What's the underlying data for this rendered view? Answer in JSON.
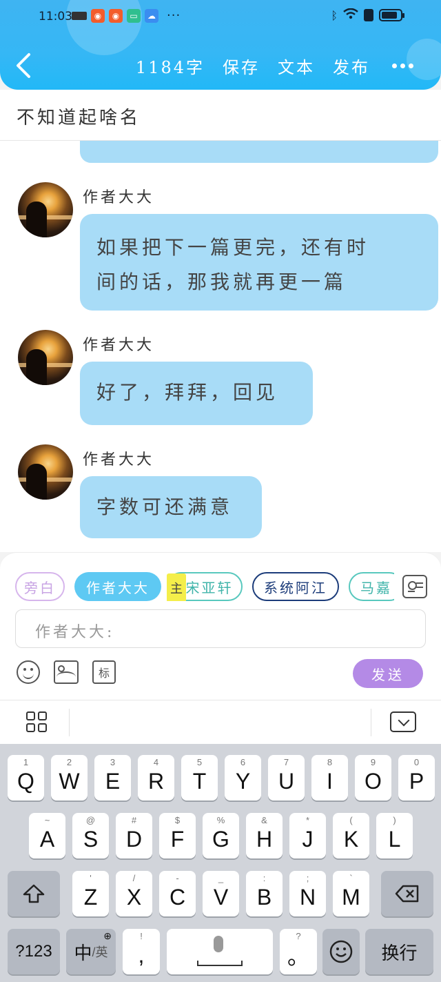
{
  "status_bar": {
    "time": "11:03",
    "more": "···"
  },
  "toolbar": {
    "word_count": "1184字",
    "save_label": "保存",
    "text_label": "文本",
    "publish_label": "发布"
  },
  "document": {
    "title": "不知道起啥名"
  },
  "messages": [
    {
      "author": "作者大大",
      "text_line1": "如果把下一篇更完，还有时",
      "text_line2": "间的话，那我就再更一篇"
    },
    {
      "author": "作者大大",
      "text": "好了，拜拜，回见"
    },
    {
      "author": "作者大大",
      "text": "字数可还满意"
    }
  ],
  "characters": {
    "chips": [
      {
        "label": "旁白"
      },
      {
        "label": "作者大大"
      },
      {
        "label": "宋亚轩",
        "tag": "主"
      },
      {
        "label": "系统阿江"
      },
      {
        "label": "马嘉"
      }
    ]
  },
  "compose": {
    "input_value": "作者大大:",
    "tag_tool_label": "标",
    "send_label": "发送"
  },
  "keyboard": {
    "row1": [
      {
        "key": "Q",
        "hint": "1"
      },
      {
        "key": "W",
        "hint": "2"
      },
      {
        "key": "E",
        "hint": "3"
      },
      {
        "key": "R",
        "hint": "4"
      },
      {
        "key": "T",
        "hint": "5"
      },
      {
        "key": "Y",
        "hint": "6"
      },
      {
        "key": "U",
        "hint": "7"
      },
      {
        "key": "I",
        "hint": "8"
      },
      {
        "key": "O",
        "hint": "9"
      },
      {
        "key": "P",
        "hint": "0"
      }
    ],
    "row2": [
      {
        "key": "A",
        "hint": "~"
      },
      {
        "key": "S",
        "hint": "@"
      },
      {
        "key": "D",
        "hint": "#"
      },
      {
        "key": "F",
        "hint": "$"
      },
      {
        "key": "G",
        "hint": "%"
      },
      {
        "key": "H",
        "hint": "&"
      },
      {
        "key": "J",
        "hint": "*"
      },
      {
        "key": "K",
        "hint": "("
      },
      {
        "key": "L",
        "hint": ")"
      }
    ],
    "row3": [
      {
        "key": "Z",
        "hint": "'"
      },
      {
        "key": "X",
        "hint": "/"
      },
      {
        "key": "C",
        "hint": "-"
      },
      {
        "key": "V",
        "hint": "_"
      },
      {
        "key": "B",
        "hint": ":"
      },
      {
        "key": "N",
        "hint": ";"
      },
      {
        "key": "M",
        "hint": "`"
      }
    ],
    "numbers_label": "?123",
    "lang_label_main": "中",
    "lang_label_sub": "/英",
    "comma_label": ",",
    "comma_hint": "!",
    "period_label": "。",
    "period_hint": "?",
    "enter_label": "换行"
  },
  "colors": {
    "header": "#35b7f5",
    "bubble": "#a8dcf7",
    "send": "#b48ae6",
    "active_chip": "#5ec9f3"
  }
}
